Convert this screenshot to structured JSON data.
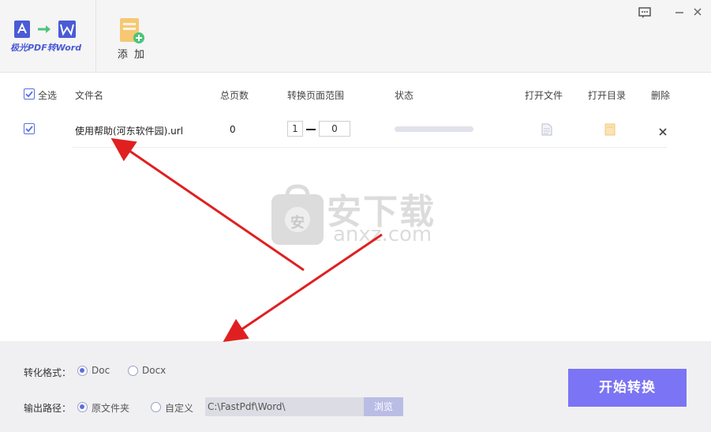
{
  "app": {
    "logo_text": "极光PDF转Word",
    "add_label": "添 加"
  },
  "table": {
    "headers": {
      "select_all": "全选",
      "filename": "文件名",
      "pages": "总页数",
      "range": "转换页面范围",
      "status": "状态",
      "open_file": "打开文件",
      "open_dir": "打开目录",
      "delete": "删除"
    },
    "rows": [
      {
        "filename": "使用帮助(河东软件园).url",
        "pages": "0",
        "range_from": "1",
        "range_to": "0",
        "progress": 0
      }
    ]
  },
  "watermark": {
    "title": "安下载",
    "sub": "anxz.com",
    "badge": "安"
  },
  "bottom": {
    "format_label": "转化格式：",
    "format_options": [
      "Doc",
      "Docx"
    ],
    "format_selected": "Doc",
    "output_label": "输出路径：",
    "output_options": [
      "原文件夹",
      "自定义"
    ],
    "output_selected": "原文件夹",
    "path_value": "C:\\FastPdf\\Word\\",
    "browse_label": "浏览",
    "start_label": "开始转换"
  },
  "colors": {
    "accent": "#7b74f4",
    "brand": "#4a5bd6",
    "arrow": "#e02020"
  }
}
